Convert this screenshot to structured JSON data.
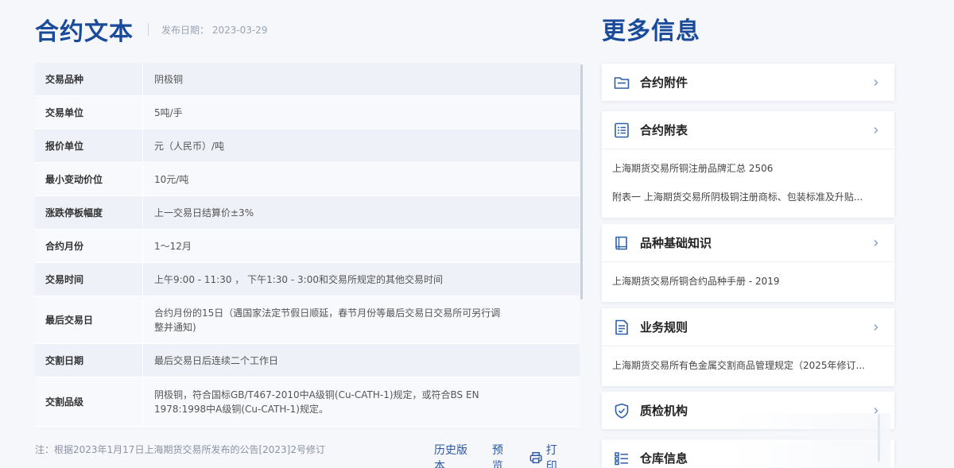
{
  "contract": {
    "title": "合约文本",
    "publish_date": "发布日期： 2023-03-29",
    "specs": [
      {
        "key": "交易品种",
        "value": "阴极铜"
      },
      {
        "key": "交易单位",
        "value": "5吨/手"
      },
      {
        "key": "报价单位",
        "value": "元（人民币）/吨"
      },
      {
        "key": "最小变动价位",
        "value": "10元/吨"
      },
      {
        "key": "涨跌停板幅度",
        "value": "上一交易日结算价±3%"
      },
      {
        "key": "合约月份",
        "value": "1～12月"
      },
      {
        "key": "交易时间",
        "value": "上午9:00 - 11:30 ， 下午1:30 - 3:00和交易所规定的其他交易时间"
      },
      {
        "key": "最后交易日",
        "value": "合约月份的15日（遇国家法定节假日顺延，春节月份等最后交易日交易所可另行调整并通知)"
      },
      {
        "key": "交割日期",
        "value": "最后交易日后连续二个工作日"
      },
      {
        "key": "交割品级",
        "value": "阴极铜，符合国标GB/T467-2010中A级铜(Cu-CATH-1)规定，或符合BS EN 1978:1998中A级铜(Cu-CATH-1)规定。"
      }
    ],
    "footnote": "注：根据2023年1月17日上海期货交易所发布的公告[2023]2号修订",
    "actions": {
      "history": "历史版本",
      "preview": "预览",
      "print": "打印"
    }
  },
  "more_info": {
    "title": "更多信息",
    "cards": [
      {
        "title": "合约附件",
        "icon": "folder-icon",
        "links": []
      },
      {
        "title": "合约附表",
        "icon": "list-doc-icon",
        "links": [
          "上海期货交易所铜注册品牌汇总 2506",
          "附表一 上海期货交易所阴极铜注册商标、包装标准及升贴..."
        ]
      },
      {
        "title": "品种基础知识",
        "icon": "book-icon",
        "links": [
          "上海期货交易所铜合约品种手册 - 2019"
        ]
      },
      {
        "title": "业务规则",
        "icon": "rules-doc-icon",
        "links": [
          "上海期货交易所有色金属交割商品管理规定（2025年修订..."
        ]
      },
      {
        "title": "质检机构",
        "icon": "shield-check-icon",
        "links": []
      },
      {
        "title": "仓库信息",
        "icon": "warehouse-list-icon",
        "links": []
      }
    ]
  },
  "colors": {
    "brand": "#1a4b9b",
    "link": "#2a56a4",
    "icon": "#2f5fa8"
  }
}
